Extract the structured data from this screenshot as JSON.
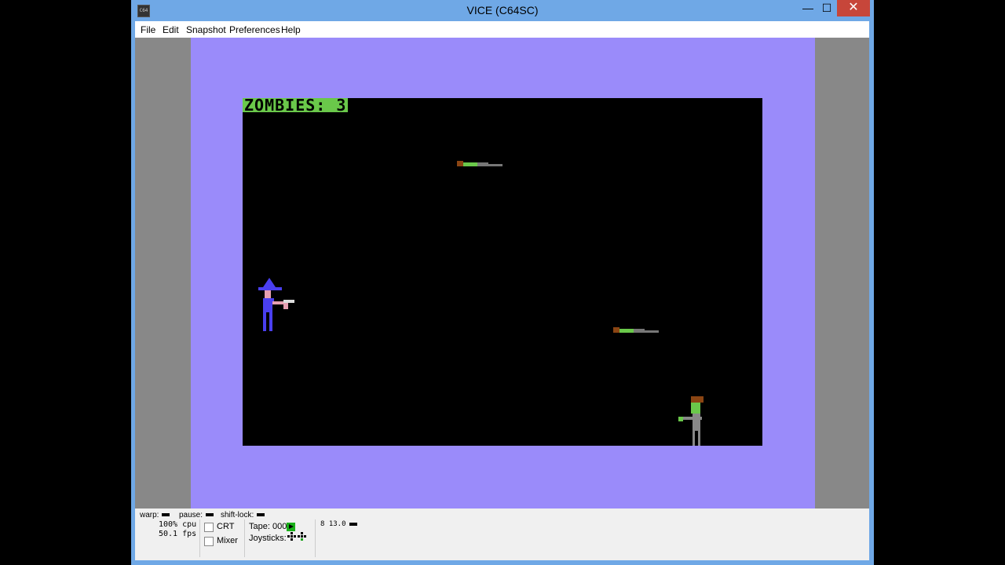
{
  "window": {
    "title": "VICE (C64SC)",
    "icon_label": "C64"
  },
  "titlebar_controls": {
    "minimize": "—",
    "maximize": "☐",
    "close": "✕"
  },
  "menu": [
    "File",
    "Edit",
    "Snapshot",
    "Preferences",
    "Help"
  ],
  "game": {
    "hud": "ZOMBIES: 3"
  },
  "status": {
    "warp_label": "warp:",
    "pause_label": "pause:",
    "shiftlock_label": "shift-lock:",
    "cpu": "100% cpu",
    "fps": "50.1 fps",
    "crt_label": "CRT",
    "mixer_label": "Mixer",
    "tape_label": "Tape:",
    "tape_counter": "000",
    "joysticks_label": "Joysticks:",
    "drive": "8 13.0"
  },
  "colors": {
    "border": "#9a8bfa",
    "hud_bg": "#6ac84a",
    "titlebar": "#6fa8e6",
    "close": "#c7463a"
  }
}
